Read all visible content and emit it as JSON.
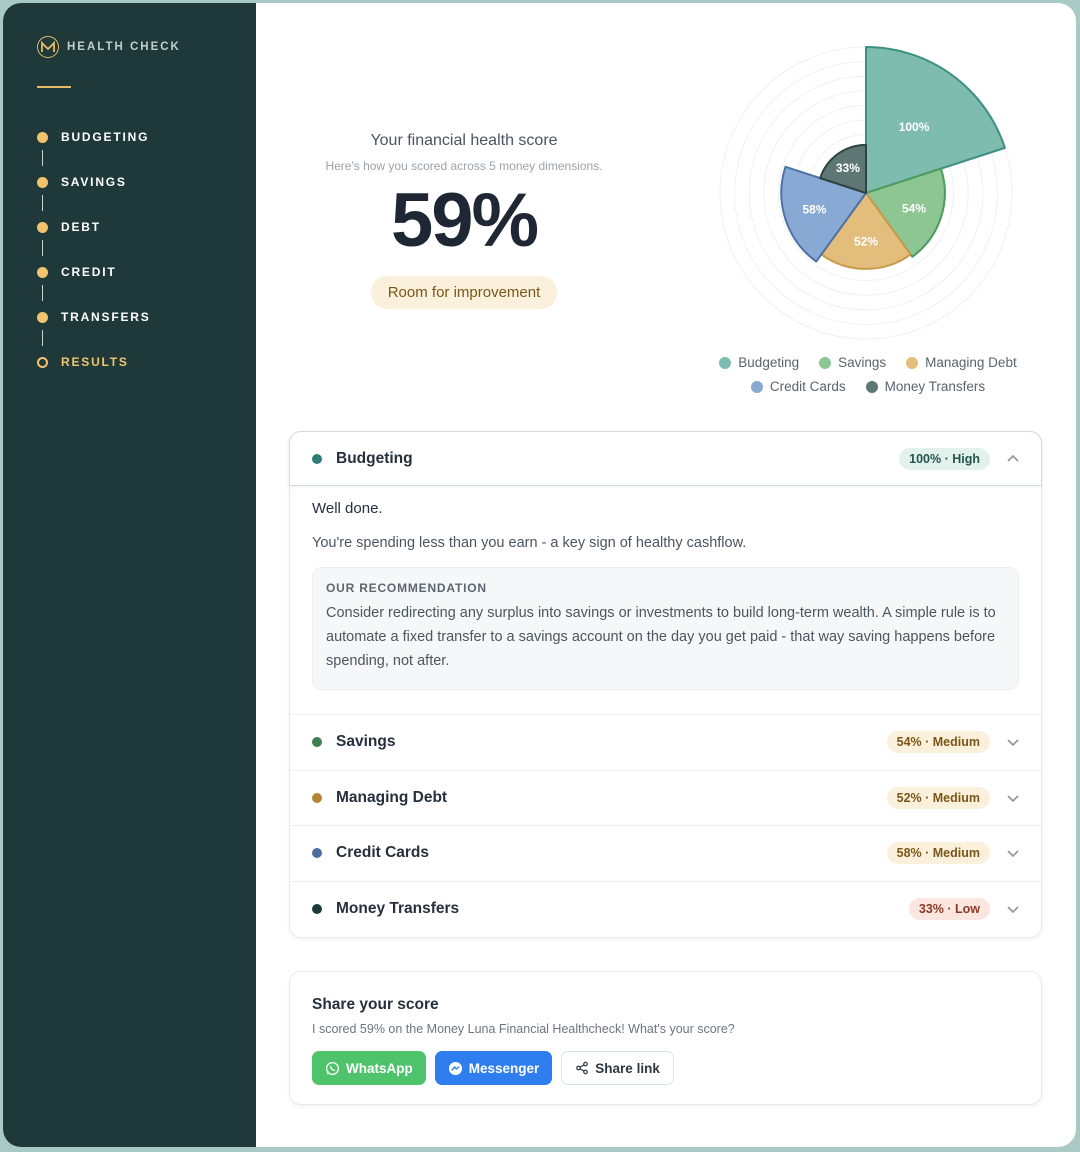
{
  "sidebar": {
    "brand": "HEALTH CHECK",
    "steps": [
      {
        "label": "BUDGETING"
      },
      {
        "label": "SAVINGS"
      },
      {
        "label": "DEBT"
      },
      {
        "label": "CREDIT"
      },
      {
        "label": "TRANSFERS"
      },
      {
        "label": "RESULTS"
      }
    ]
  },
  "score": {
    "title": "Your financial health score",
    "subtitle": "Here's how you scored across 5 money dimensions.",
    "value": "59%",
    "badge": "Room for improvement"
  },
  "chart_data": {
    "type": "polar-area",
    "categories": [
      "Budgeting",
      "Savings",
      "Managing Debt",
      "Credit Cards",
      "Money Transfers"
    ],
    "values": [
      100,
      54,
      52,
      58,
      33
    ],
    "labels": [
      "100%",
      "54%",
      "52%",
      "58%",
      "33%"
    ],
    "colors": [
      "#7ebcb0",
      "#8dc593",
      "#e2bd7c",
      "#88a9d3",
      "#5f7774"
    ],
    "legend": "bottom"
  },
  "legend": {
    "items": [
      {
        "label": "Budgeting",
        "color": "#7ebcb0"
      },
      {
        "label": "Savings",
        "color": "#8dc593"
      },
      {
        "label": "Managing Debt",
        "color": "#e2bd7c"
      },
      {
        "label": "Credit Cards",
        "color": "#88a9d3"
      },
      {
        "label": "Money Transfers",
        "color": "#5f7774"
      }
    ]
  },
  "accordion": {
    "open": {
      "title": "Budgeting",
      "badge": "100% · High",
      "dot_color": "#2d7b76",
      "lead": "Well done.",
      "description": "You're spending less than you earn - a key sign of healthy cashflow.",
      "rec_title": "OUR RECOMMENDATION",
      "rec_text": "Consider redirecting any surplus into savings or investments to build long-term wealth. A simple rule is to automate a fixed transfer to a savings account on the day you get paid - that way saving happens before spending, not after."
    },
    "items": [
      {
        "title": "Savings",
        "badge": "54% · Medium",
        "dot_color": "#3f7d55"
      },
      {
        "title": "Managing Debt",
        "badge": "52% · Medium",
        "dot_color": "#b58236"
      },
      {
        "title": "Credit Cards",
        "badge": "58% · Medium",
        "dot_color": "#4d6f9d"
      },
      {
        "title": "Money Transfers",
        "badge": "33% · Low",
        "dot_color": "#1e3a3a"
      }
    ]
  },
  "share": {
    "title": "Share your score",
    "text": "I scored 59% on the Money Luna Financial Healthcheck! What's your score?",
    "whatsapp": "WhatsApp",
    "messenger": "Messenger",
    "link": "Share link"
  }
}
